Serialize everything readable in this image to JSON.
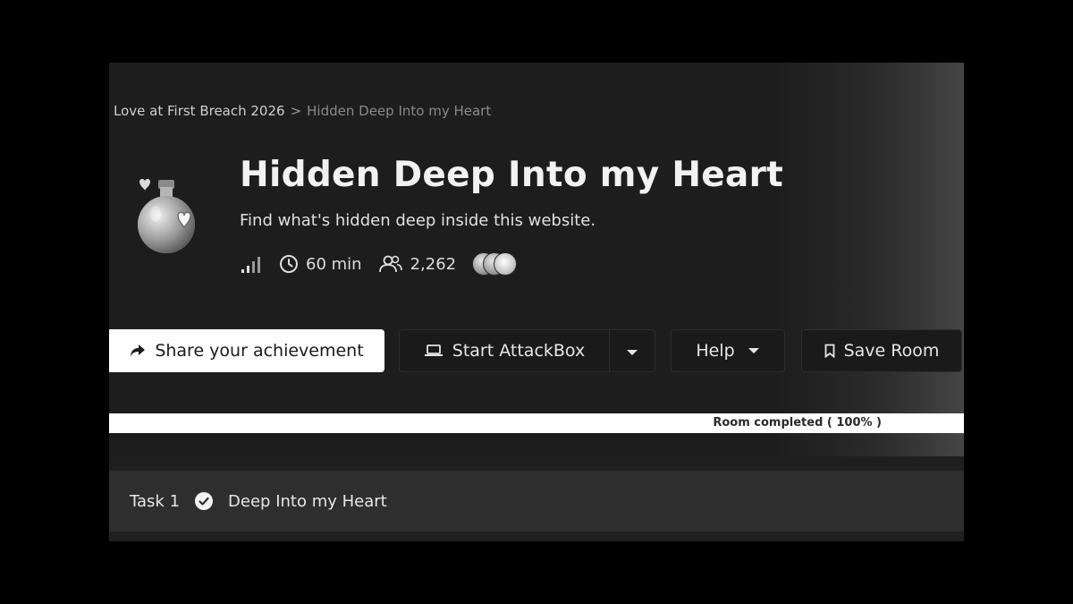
{
  "breadcrumb": {
    "parent": "Love at First Breach 2026",
    "separator": ">",
    "current": "Hidden Deep Into my Heart"
  },
  "room": {
    "title": "Hidden Deep Into my Heart",
    "description": "Find what's hidden deep inside this website.",
    "difficulty_icon": "signal-bars-icon",
    "duration": "60 min",
    "users": "2,262"
  },
  "buttons": {
    "share_label": "Share your achievement",
    "attackbox_label": "Start AttackBox",
    "help_label": "Help",
    "save_label": "Save Room"
  },
  "progress": {
    "label": "Room completed ( 100% )",
    "percent": 100
  },
  "task": {
    "number_label": "Task 1",
    "name": "Deep Into my Heart",
    "completed": true
  },
  "colors": {
    "background": "#1f1f1f",
    "share_button": "#ffffff",
    "task_row": "#2e2e2e"
  }
}
